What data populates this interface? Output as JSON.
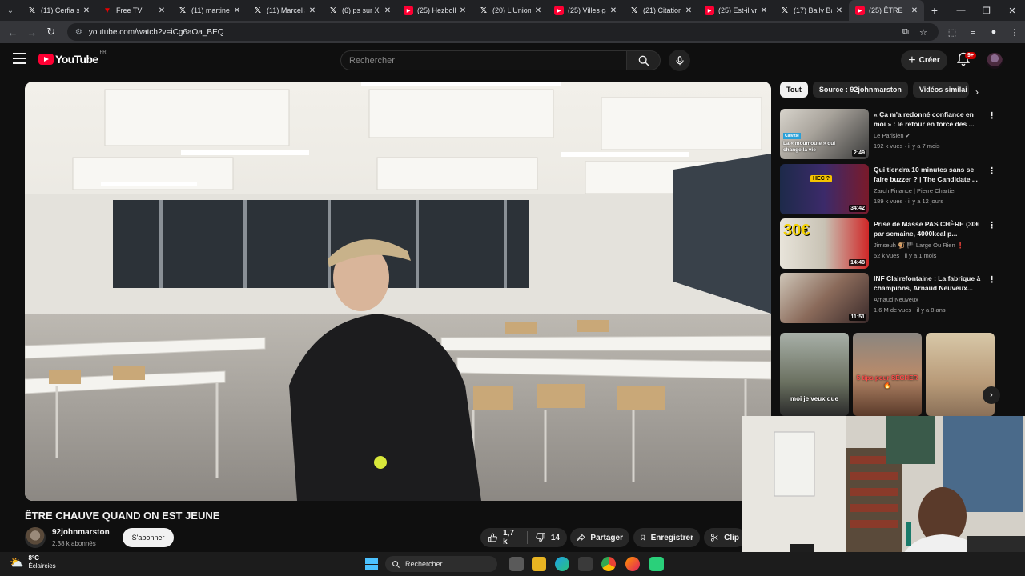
{
  "browser": {
    "tabs": [
      {
        "title": "(11) Cerfia sur X",
        "icon": "x-icon"
      },
      {
        "title": "Free TV",
        "icon": "free-tv-icon"
      },
      {
        "title": "(11) martine sur X",
        "icon": "x-icon"
      },
      {
        "title": "(11) Marcel sur X",
        "icon": "x-icon"
      },
      {
        "title": "(6) ps sur X",
        "icon": "x-icon"
      },
      {
        "title": "(25) Hezbollah",
        "icon": "youtube-icon"
      },
      {
        "title": "(20) L'Union",
        "icon": "x-icon"
      },
      {
        "title": "(25) Villes gay",
        "icon": "youtube-icon"
      },
      {
        "title": "(21) Citation",
        "icon": "x-icon"
      },
      {
        "title": "(25) Est-il vrai",
        "icon": "youtube-icon"
      },
      {
        "title": "(17) Bally Bat",
        "icon": "x-icon"
      },
      {
        "title": "(25) ÊTRE",
        "icon": "youtube-icon",
        "active": true
      }
    ],
    "url": "youtube.com/watch?v=iCg6aOa_BEQ"
  },
  "youtube": {
    "logo_text": "YouTube",
    "country_code": "FR",
    "search_placeholder": "Rechercher",
    "create_label": "Créer",
    "notification_count": "9+"
  },
  "video": {
    "title": "ÊTRE CHAUVE QUAND ON EST JEUNE",
    "channel": "92johnmarston",
    "subscribers": "2,38 k abonnés",
    "subscribe_label": "S'abonner",
    "likes": "1,7 k",
    "dislikes": "14",
    "share_label": "Partager",
    "save_label": "Enregistrer",
    "clip_label": "Clip"
  },
  "sidebar": {
    "chips": [
      "Tout",
      "Source : 92johnmarston",
      "Vidéos similai"
    ],
    "videos": [
      {
        "title": "« Ça m'a redonné confiance en moi » : le retour en force des ...",
        "channel": "Le Parisien",
        "verified": true,
        "meta": "192 k vues · il y a 7 mois",
        "duration": "2:49",
        "thumb_caption": "La « moumoute » qui change la vie",
        "thumb_badge": "Calvitie"
      },
      {
        "title": "Qui tiendra 10 minutes sans se faire buzzer ? | The Candidate ...",
        "channel": "Zarch Finance | Pierre Chartier",
        "meta": "189 k vues · il y a 12 jours",
        "duration": "34:42",
        "thumb_caption": "HEC ?"
      },
      {
        "title": "Prise de Masse PAS CHÈRE (30€ par semaine, 4000kcal p...",
        "channel": "Jimseuh 🐒 🏴 Large Ou Rien ❗",
        "meta": "52 k vues · il y a 1 mois",
        "duration": "14:48",
        "thumb_caption": "30€"
      },
      {
        "title": "INF Clairefontaine : La fabrique à champions, Arnaud Neuveux...",
        "channel": "Arnaud Neuveux",
        "meta": "1,6 M de vues · il y a 8 ans",
        "duration": "11:51"
      }
    ],
    "shorts": [
      {
        "caption": "moi je veux que"
      },
      {
        "caption": "5 tips pour SÉCHER 🔥"
      },
      {
        "caption": ""
      }
    ]
  },
  "taskbar": {
    "temperature": "8°C",
    "weather": "Éclaircies",
    "search_label": "Rechercher"
  }
}
